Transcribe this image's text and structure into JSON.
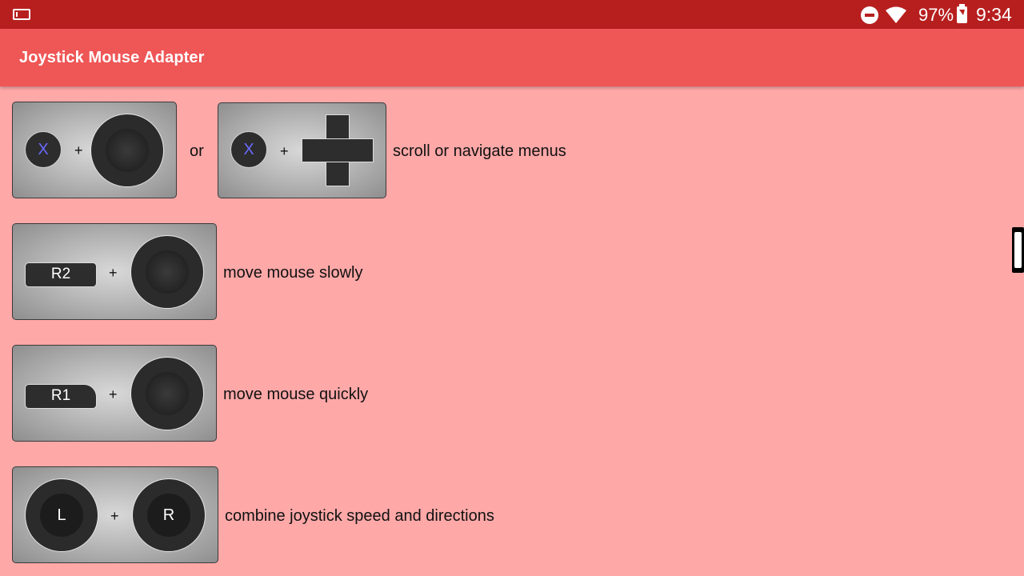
{
  "status_bar": {
    "battery_percent": "97%",
    "time": "9:34",
    "icons": [
      "screen-icon",
      "do-not-disturb-icon",
      "wifi-icon",
      "battery-charging-icon"
    ]
  },
  "app_bar": {
    "title": "Joystick Mouse Adapter"
  },
  "rows": [
    {
      "desc": "scroll or navigate menus",
      "button": "X",
      "joiner": "or"
    },
    {
      "desc": "move mouse slowly",
      "button": "R2"
    },
    {
      "desc": "move mouse quickly",
      "button": "R1"
    },
    {
      "desc": "combine joystick speed and directions",
      "left_stick": "L",
      "right_stick": "R"
    }
  ],
  "plus": "+",
  "colors": {
    "status_bar": "#b71f1f",
    "app_bar": "#ef5656",
    "background": "#ffa8a8",
    "x_button_text": "#6a6aff"
  }
}
